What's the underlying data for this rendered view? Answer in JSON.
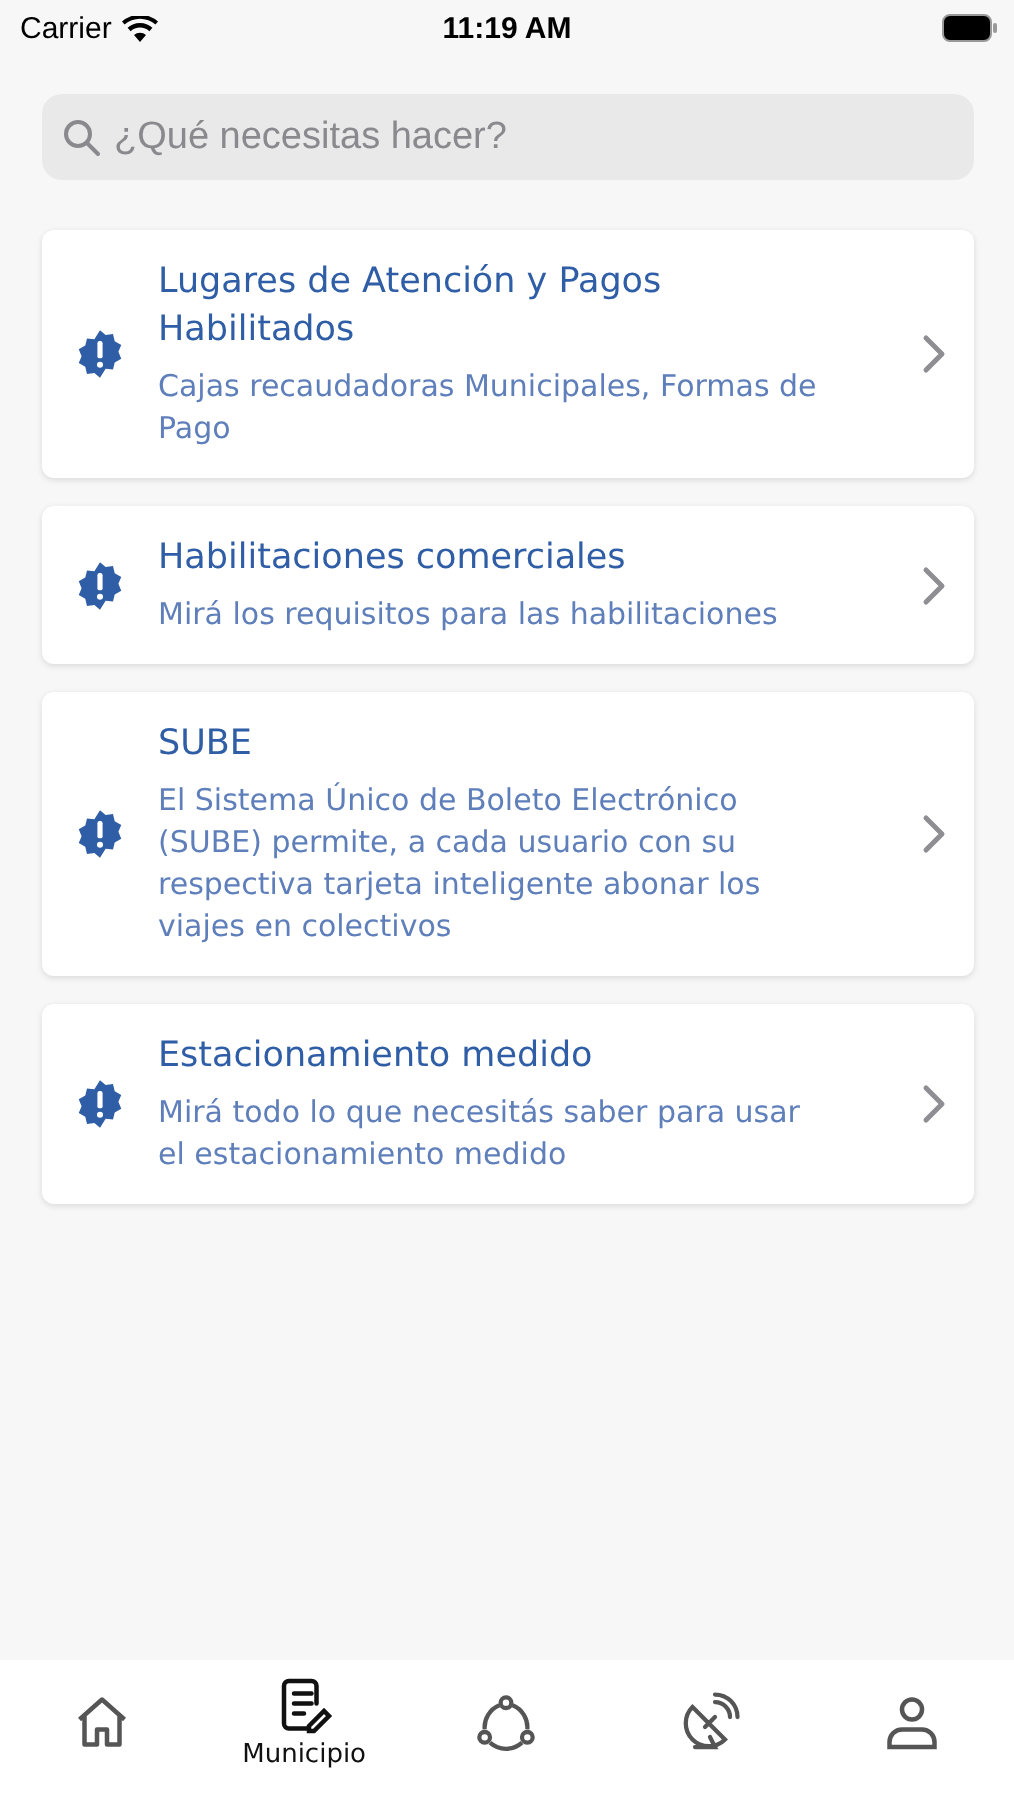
{
  "status_bar": {
    "carrier": "Carrier",
    "time": "11:19 AM"
  },
  "search": {
    "placeholder": "¿Qué necesitas hacer?"
  },
  "items": [
    {
      "title": "Lugares de Atención y Pagos Habilitados",
      "description": "Cajas recaudadoras Municipales, Formas de Pago"
    },
    {
      "title": "Habilitaciones comerciales",
      "description": "Mirá los requisitos para las habilitaciones"
    },
    {
      "title": "SUBE",
      "description": "El Sistema Único de Boleto Electrónico (SUBE) permite, a cada usuario con su respectiva tarjeta inteligente abonar los viajes en colectivos"
    },
    {
      "title": "Estacionamiento medido",
      "description": "Mirá todo lo que necesitás saber para usar el estacionamiento medido"
    }
  ],
  "tabs": [
    {
      "kind": "home",
      "selected": false
    },
    {
      "kind": "document",
      "label": "Municipio",
      "selected": true
    },
    {
      "kind": "network",
      "selected": false
    },
    {
      "kind": "antenna",
      "selected": false
    },
    {
      "kind": "profile",
      "selected": false
    }
  ]
}
